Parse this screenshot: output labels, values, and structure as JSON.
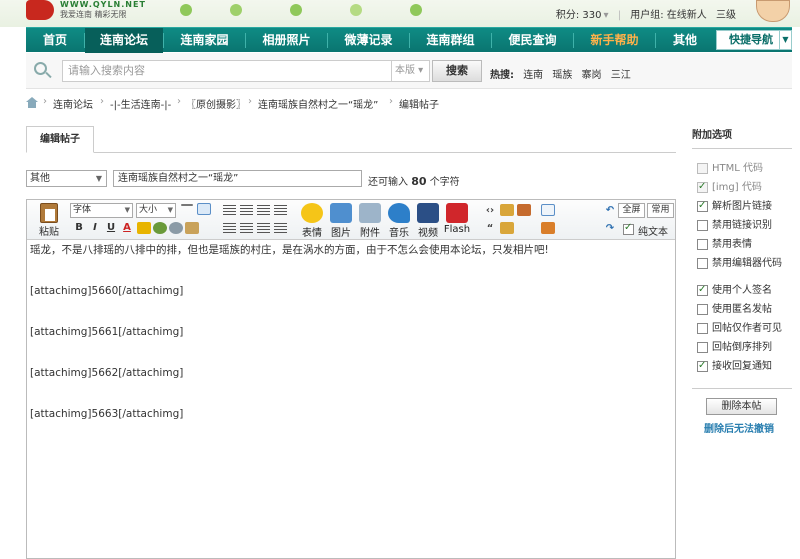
{
  "header": {
    "site": "WWW.QYLN.NET",
    "slogan": "我爱连南 精彩无限",
    "points_label": "积分: 330",
    "usergroup_label": "用户组: 在线新人",
    "level": "三级"
  },
  "nav": {
    "items": [
      "首页",
      "连南论坛",
      "连南家园",
      "相册照片",
      "微薄记录",
      "连南群组",
      "便民查询",
      "新手帮助",
      "其他"
    ],
    "quick_nav": "快捷导航"
  },
  "search": {
    "placeholder": "请输入搜索内容",
    "scope": "本版",
    "button": "搜索",
    "hot_label": "热搜:",
    "hot_items": [
      "连南",
      "瑶族",
      "寨岗",
      "三江"
    ]
  },
  "breadcrumb": [
    "连南论坛",
    "-|-生活连南-|-",
    "〖原创摄影〗",
    "连南瑶族自然村之一“瑶龙”",
    "编辑帖子"
  ],
  "editor": {
    "tab": "编辑帖子",
    "category": "其他",
    "title": "连南瑶族自然村之一“瑶龙”",
    "remain_prefix": "还可输入",
    "remain_count": "80",
    "remain_suffix": "个字符",
    "toolbar": {
      "paste": "粘贴",
      "font": "字体",
      "size": "大小",
      "emoji": "表情",
      "image": "图片",
      "attach": "附件",
      "music": "音乐",
      "video": "视频",
      "flash": "Flash",
      "fullscreen": "全屏",
      "common": "常用",
      "plaintext": "纯文本"
    },
    "content": [
      "瑶龙，不是八排瑶的八排中的排，但也是瑶族的村庄，是在涡水的方面，由于不怎么会使用本论坛，只发相片吧!",
      "[attachimg]5660[/attachimg]",
      "[attachimg]5661[/attachimg]",
      "[attachimg]5662[/attachimg]",
      "[attachimg]5663[/attachimg]"
    ]
  },
  "sidebar": {
    "title": "附加选项",
    "options": [
      {
        "label": "HTML 代码",
        "checked": false,
        "disabled": true
      },
      {
        "label": "[img] 代码",
        "checked": true,
        "disabled": true
      },
      {
        "label": "解析图片链接",
        "checked": true,
        "disabled": false
      },
      {
        "label": "禁用链接识别",
        "checked": false,
        "disabled": false
      },
      {
        "label": "禁用表情",
        "checked": false,
        "disabled": false
      },
      {
        "label": "禁用编辑器代码",
        "checked": false,
        "disabled": false
      },
      {
        "label": "使用个人签名",
        "checked": true,
        "disabled": false
      },
      {
        "label": "使用匿名发帖",
        "checked": false,
        "disabled": false
      },
      {
        "label": "回帖仅作者可见",
        "checked": false,
        "disabled": false
      },
      {
        "label": "回帖倒序排列",
        "checked": false,
        "disabled": false
      },
      {
        "label": "接收回复通知",
        "checked": true,
        "disabled": false
      }
    ],
    "delete_button": "删除本帖",
    "delete_note": "删除后无法撤销"
  }
}
